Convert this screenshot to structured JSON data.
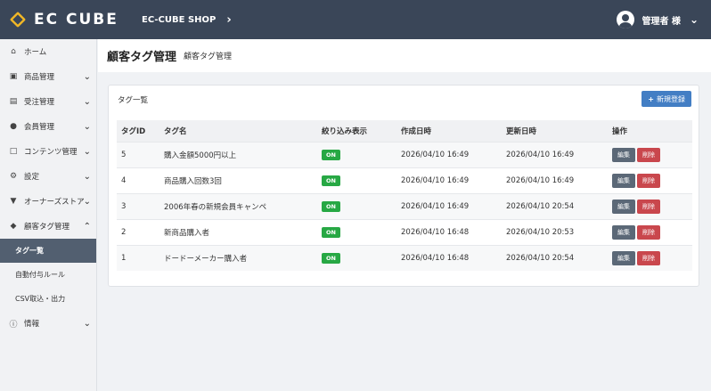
{
  "header": {
    "logo_text": "EC CUBE",
    "shop_name": "EC-CUBE SHOP",
    "user_name": "管理者 様"
  },
  "sidebar": {
    "items": [
      {
        "label": "ホーム",
        "icon": "home-icon"
      },
      {
        "label": "商品管理",
        "icon": "box-icon"
      },
      {
        "label": "受注管理",
        "icon": "cart-icon"
      },
      {
        "label": "会員管理",
        "icon": "users-icon"
      },
      {
        "label": "コンテンツ管理",
        "icon": "file-icon"
      },
      {
        "label": "設定",
        "icon": "gear-icon"
      },
      {
        "label": "オーナーズストア",
        "icon": "plug-icon"
      },
      {
        "label": "顧客タグ管理",
        "icon": "tag-icon"
      }
    ],
    "sub_items": [
      {
        "label": "タグ一覧",
        "active": true
      },
      {
        "label": "自動付与ルール",
        "active": false
      },
      {
        "label": "CSV取込・出力",
        "active": false
      }
    ],
    "info_item": {
      "label": "情報",
      "icon": "info-icon"
    }
  },
  "page": {
    "title": "顧客タグ管理",
    "subtitle": "顧客タグ管理"
  },
  "card": {
    "title": "タグ一覧",
    "new_button": "新規登録",
    "columns": [
      "タグID",
      "タグ名",
      "絞り込み表示",
      "作成日時",
      "更新日時",
      "操作"
    ],
    "rows": [
      {
        "id": "5",
        "name": "購入金額5000円以上",
        "filter": "ON",
        "created": "2026/04/10 16:49",
        "updated": "2026/04/10 16:49"
      },
      {
        "id": "4",
        "name": "商品購入回数3回",
        "filter": "ON",
        "created": "2026/04/10 16:49",
        "updated": "2026/04/10 16:49"
      },
      {
        "id": "3",
        "name": "2006年春の新規会員キャンペ",
        "filter": "ON",
        "created": "2026/04/10 16:49",
        "updated": "2026/04/10 20:54"
      },
      {
        "id": "2",
        "name": "新商品購入者",
        "filter": "ON",
        "created": "2026/04/10 16:48",
        "updated": "2026/04/10 20:53"
      },
      {
        "id": "1",
        "name": "ドードーメーカー購入者",
        "filter": "ON",
        "created": "2026/04/10 16:48",
        "updated": "2026/04/10 20:54"
      }
    ],
    "edit_label": "編集",
    "delete_label": "削除"
  },
  "colors": {
    "header_bg": "#3a4658",
    "logo_accent": "#f2b826",
    "primary": "#437ec4",
    "badge_on": "#27a844",
    "danger": "#c9474d",
    "edit_btn": "#5b6877"
  }
}
